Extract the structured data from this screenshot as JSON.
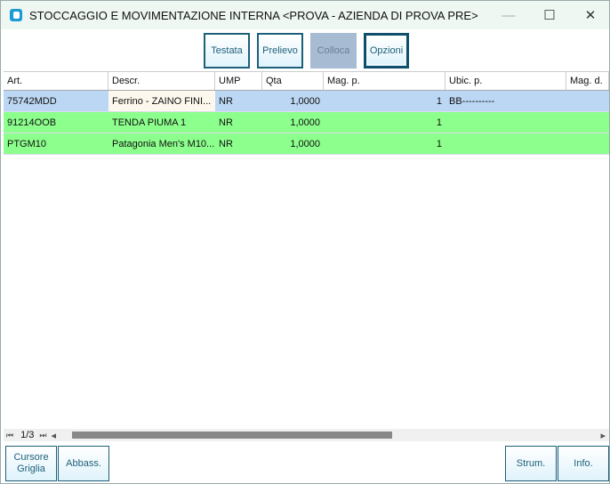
{
  "window": {
    "title": "STOCCAGGIO E MOVIMENTAZIONE INTERNA <PROVA - AZIENDA DI PROVA PRE>",
    "minimize": "—",
    "maximize": "☐",
    "close": "✕"
  },
  "tabs": [
    {
      "label": "Testata"
    },
    {
      "label": "Prelievo"
    },
    {
      "label": "Colloca"
    },
    {
      "label": "Opzioni"
    }
  ],
  "grid": {
    "columns": [
      "Art.",
      "Descr.",
      "UMP",
      "Qta",
      "Mag. p.",
      "Ubic. p.",
      "Mag. d."
    ],
    "rows": [
      [
        "75742MDD",
        "Ferrino - ZAINO FINI...",
        "NR",
        "1,0000",
        "1",
        "BB----------",
        ""
      ],
      [
        "91214OOB",
        "TENDA PIUMA 1",
        "NR",
        "1,0000",
        "1",
        "",
        ""
      ],
      [
        "PTGM10",
        "Patagonia Men's M10...",
        "NR",
        "1,0000",
        "1",
        "",
        ""
      ]
    ]
  },
  "pager": {
    "first": "⏮",
    "page": "1/3",
    "last": "⏭",
    "left": "◂",
    "right": "▸"
  },
  "buttons": {
    "cursor_line1": "Cursore",
    "cursor_line2": "Griglia",
    "abbass": "Abbass.",
    "strum": "Strum.",
    "info": "Info."
  }
}
